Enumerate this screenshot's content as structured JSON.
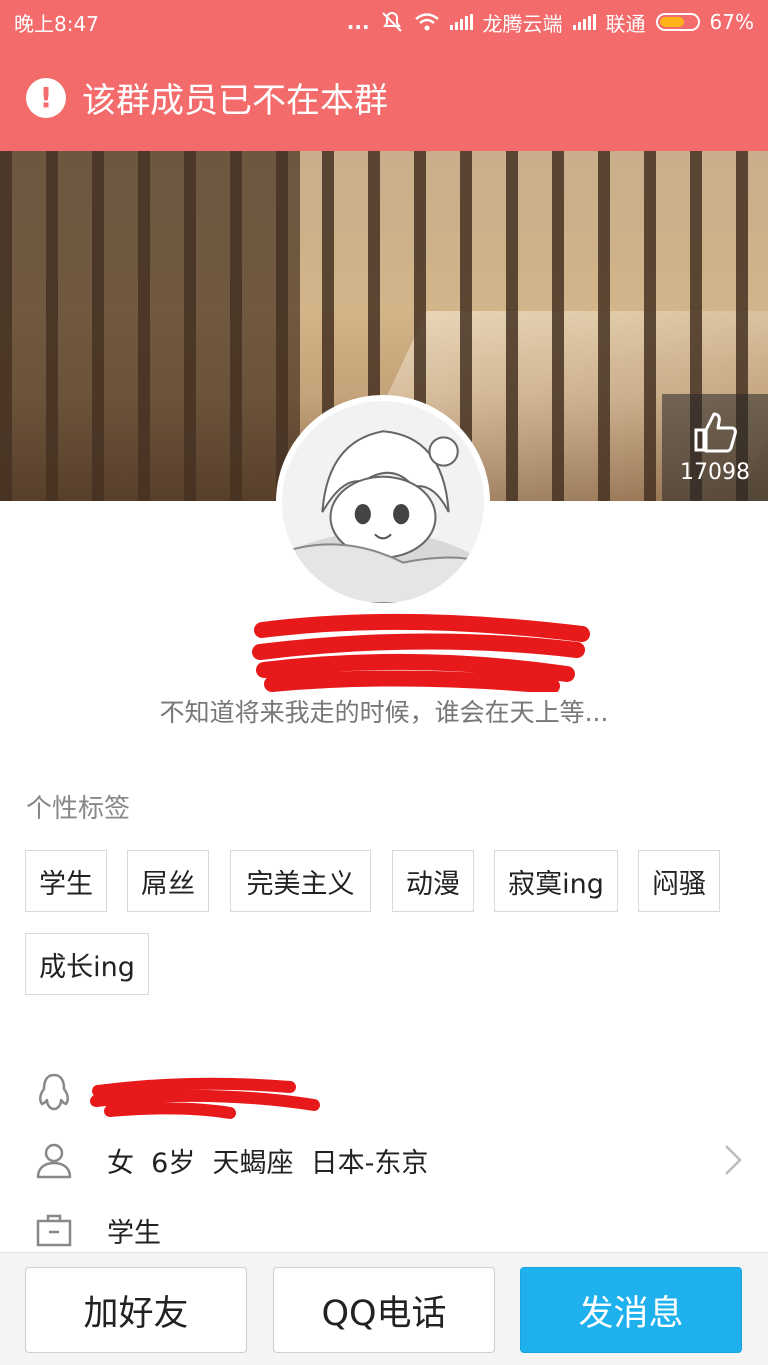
{
  "status_bar": {
    "time": "晚上8:47",
    "dots": "...",
    "carrier1": "龙腾云端",
    "carrier2": "联通",
    "battery_percent": "67%",
    "battery_level": 0.67,
    "icons": [
      "mute-icon",
      "wifi-icon",
      "signal-icon",
      "signal-icon",
      "battery-icon"
    ]
  },
  "alert": {
    "icon": "exclamation-icon",
    "text": "该群成员已不在本群"
  },
  "cover": {
    "like_icon": "thumbs-up-icon",
    "like_count": "17098"
  },
  "profile": {
    "signature": "不知道将来我走的时候，谁会在天上等..."
  },
  "tags_section": {
    "title": "个性标签",
    "tags": [
      "学生",
      "屌丝",
      "完美主义",
      "动漫",
      "寂寞ing",
      "闷骚",
      "成长ing"
    ]
  },
  "info": {
    "basic": "女  6岁  天蝎座  日本-东京",
    "occupation": "学生"
  },
  "bottom_bar": {
    "add_friend": "加好友",
    "qq_call": "QQ电话",
    "send_message": "发消息"
  },
  "colors": {
    "header_red": "#f36b6b",
    "primary_blue": "#1eb1ee",
    "battery_orange": "#ffb21c"
  }
}
